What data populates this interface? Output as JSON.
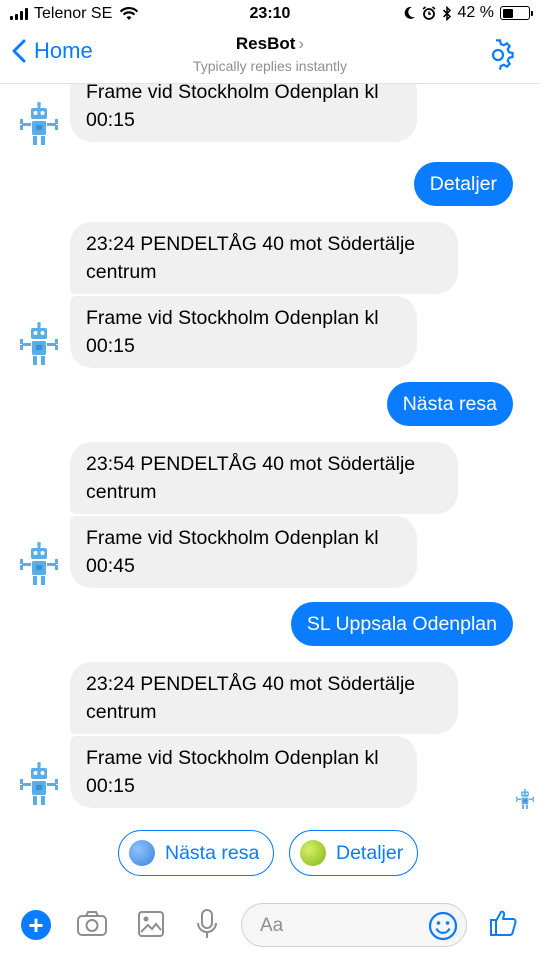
{
  "status_bar": {
    "carrier": "Telenor SE",
    "time": "23:10",
    "battery": "42 %"
  },
  "nav": {
    "back_label": "Home",
    "title": "ResBot",
    "subtitle": "Typically replies instantly"
  },
  "messages": [
    {
      "from": "bot",
      "text": "Frame vid Stockholm Odenplan kl 00:15"
    },
    {
      "from": "user",
      "text": "Detaljer"
    },
    {
      "from": "bot",
      "text": "23:24 PENDELTÅG  40 mot Södertälje centrum"
    },
    {
      "from": "bot",
      "text": "Frame vid Stockholm Odenplan kl 00:15"
    },
    {
      "from": "user",
      "text": "Nästa resa"
    },
    {
      "from": "bot",
      "text": "23:54 PENDELTÅG  40 mot Södertälje centrum"
    },
    {
      "from": "bot",
      "text": "Frame vid Stockholm Odenplan kl 00:45"
    },
    {
      "from": "user",
      "text": "SL Uppsala Odenplan"
    },
    {
      "from": "bot",
      "text": "23:24 PENDELTÅG  40 mot Södertälje centrum"
    },
    {
      "from": "bot",
      "text": "Frame vid Stockholm Odenplan kl 00:15"
    }
  ],
  "quick_replies": [
    {
      "label": "Nästa resa",
      "dot_color": "#4a90e2",
      "icon": "blue-circle-icon"
    },
    {
      "label": "Detaljer",
      "dot_color": "#9acd1e",
      "icon": "green-circle-icon"
    }
  ],
  "composer": {
    "placeholder": "Aa"
  },
  "colors": {
    "accent": "#0a7cff",
    "incoming_bubble": "#f1f0f0"
  }
}
